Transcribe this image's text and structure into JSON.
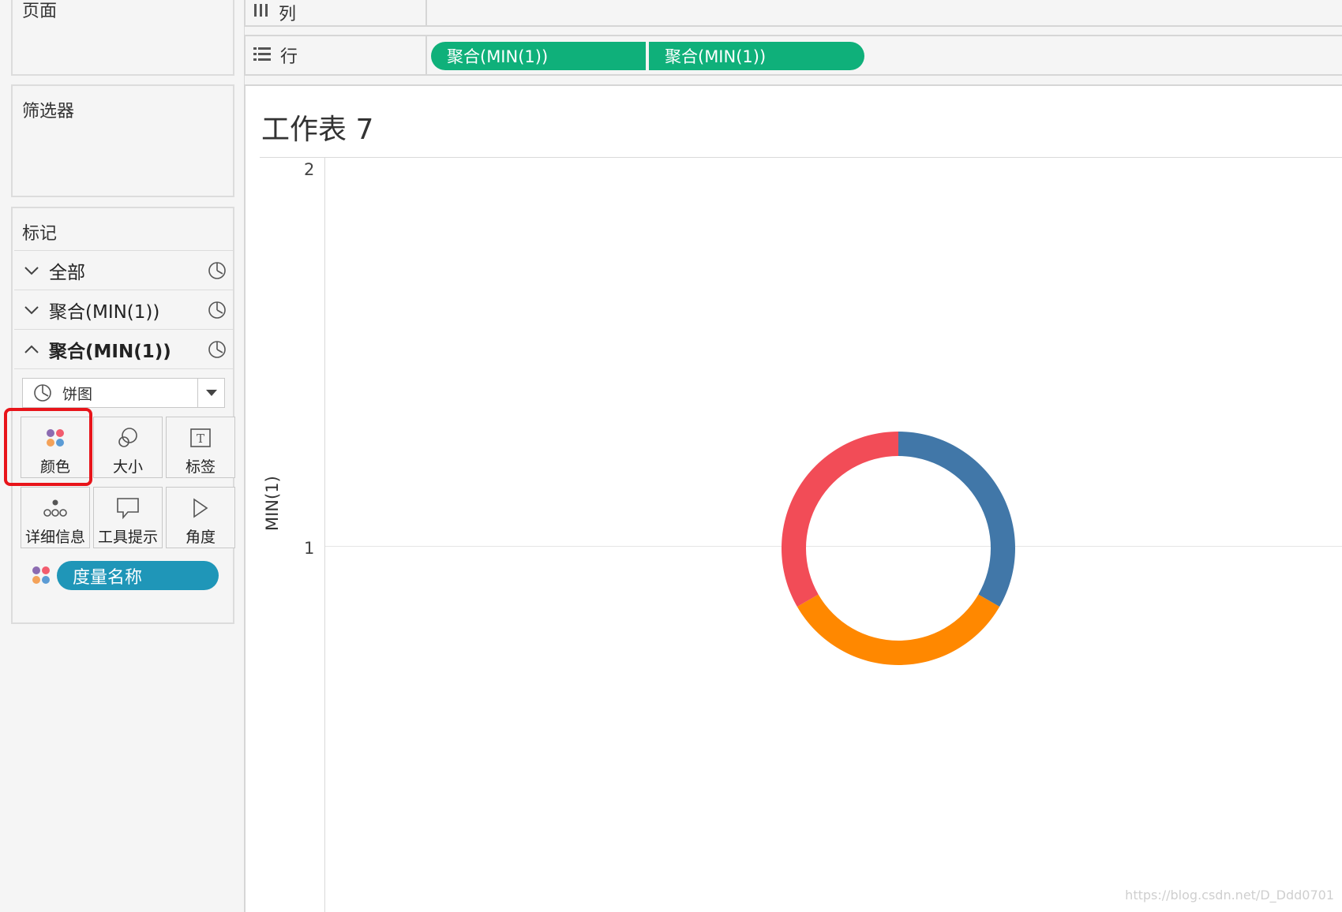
{
  "left_panel": {
    "pages_title": "页面",
    "filters_title": "筛选器",
    "marks_title": "标记",
    "marks_rows": [
      {
        "label": "全部",
        "expanded": false
      },
      {
        "label": "聚合(MIN(1))",
        "expanded": false
      },
      {
        "label": "聚合(MIN(1))",
        "expanded": true
      }
    ],
    "mark_type": "饼图",
    "buttons": {
      "color": "颜色",
      "size": "大小",
      "label": "标签",
      "detail": "详细信息",
      "tooltip": "工具提示",
      "angle": "角度"
    },
    "color_field": "度量名称"
  },
  "shelves": {
    "columns_label": "列",
    "rows_label": "行",
    "row_pills": [
      "聚合(MIN(1))",
      "聚合(MIN(1))"
    ]
  },
  "sheet": {
    "title": "工作表 7",
    "y_axis_label": "MIN(1)",
    "ticks": [
      "2",
      "1"
    ]
  },
  "watermark": "https://blog.csdn.net/D_Ddd0701",
  "chart_data": {
    "type": "pie",
    "ticks": [
      "2",
      "1"
    ],
    "ylabel": "MIN(1)",
    "slices": [
      {
        "color": "#4177a8",
        "value": 1
      },
      {
        "color": "#ff8800",
        "value": 1
      },
      {
        "color": "#f24c57",
        "value": 1
      }
    ]
  },
  "colors": {
    "green_pill": "#0fb07a",
    "teal_pill": "#1f96b8",
    "highlight": "#e8141a"
  }
}
